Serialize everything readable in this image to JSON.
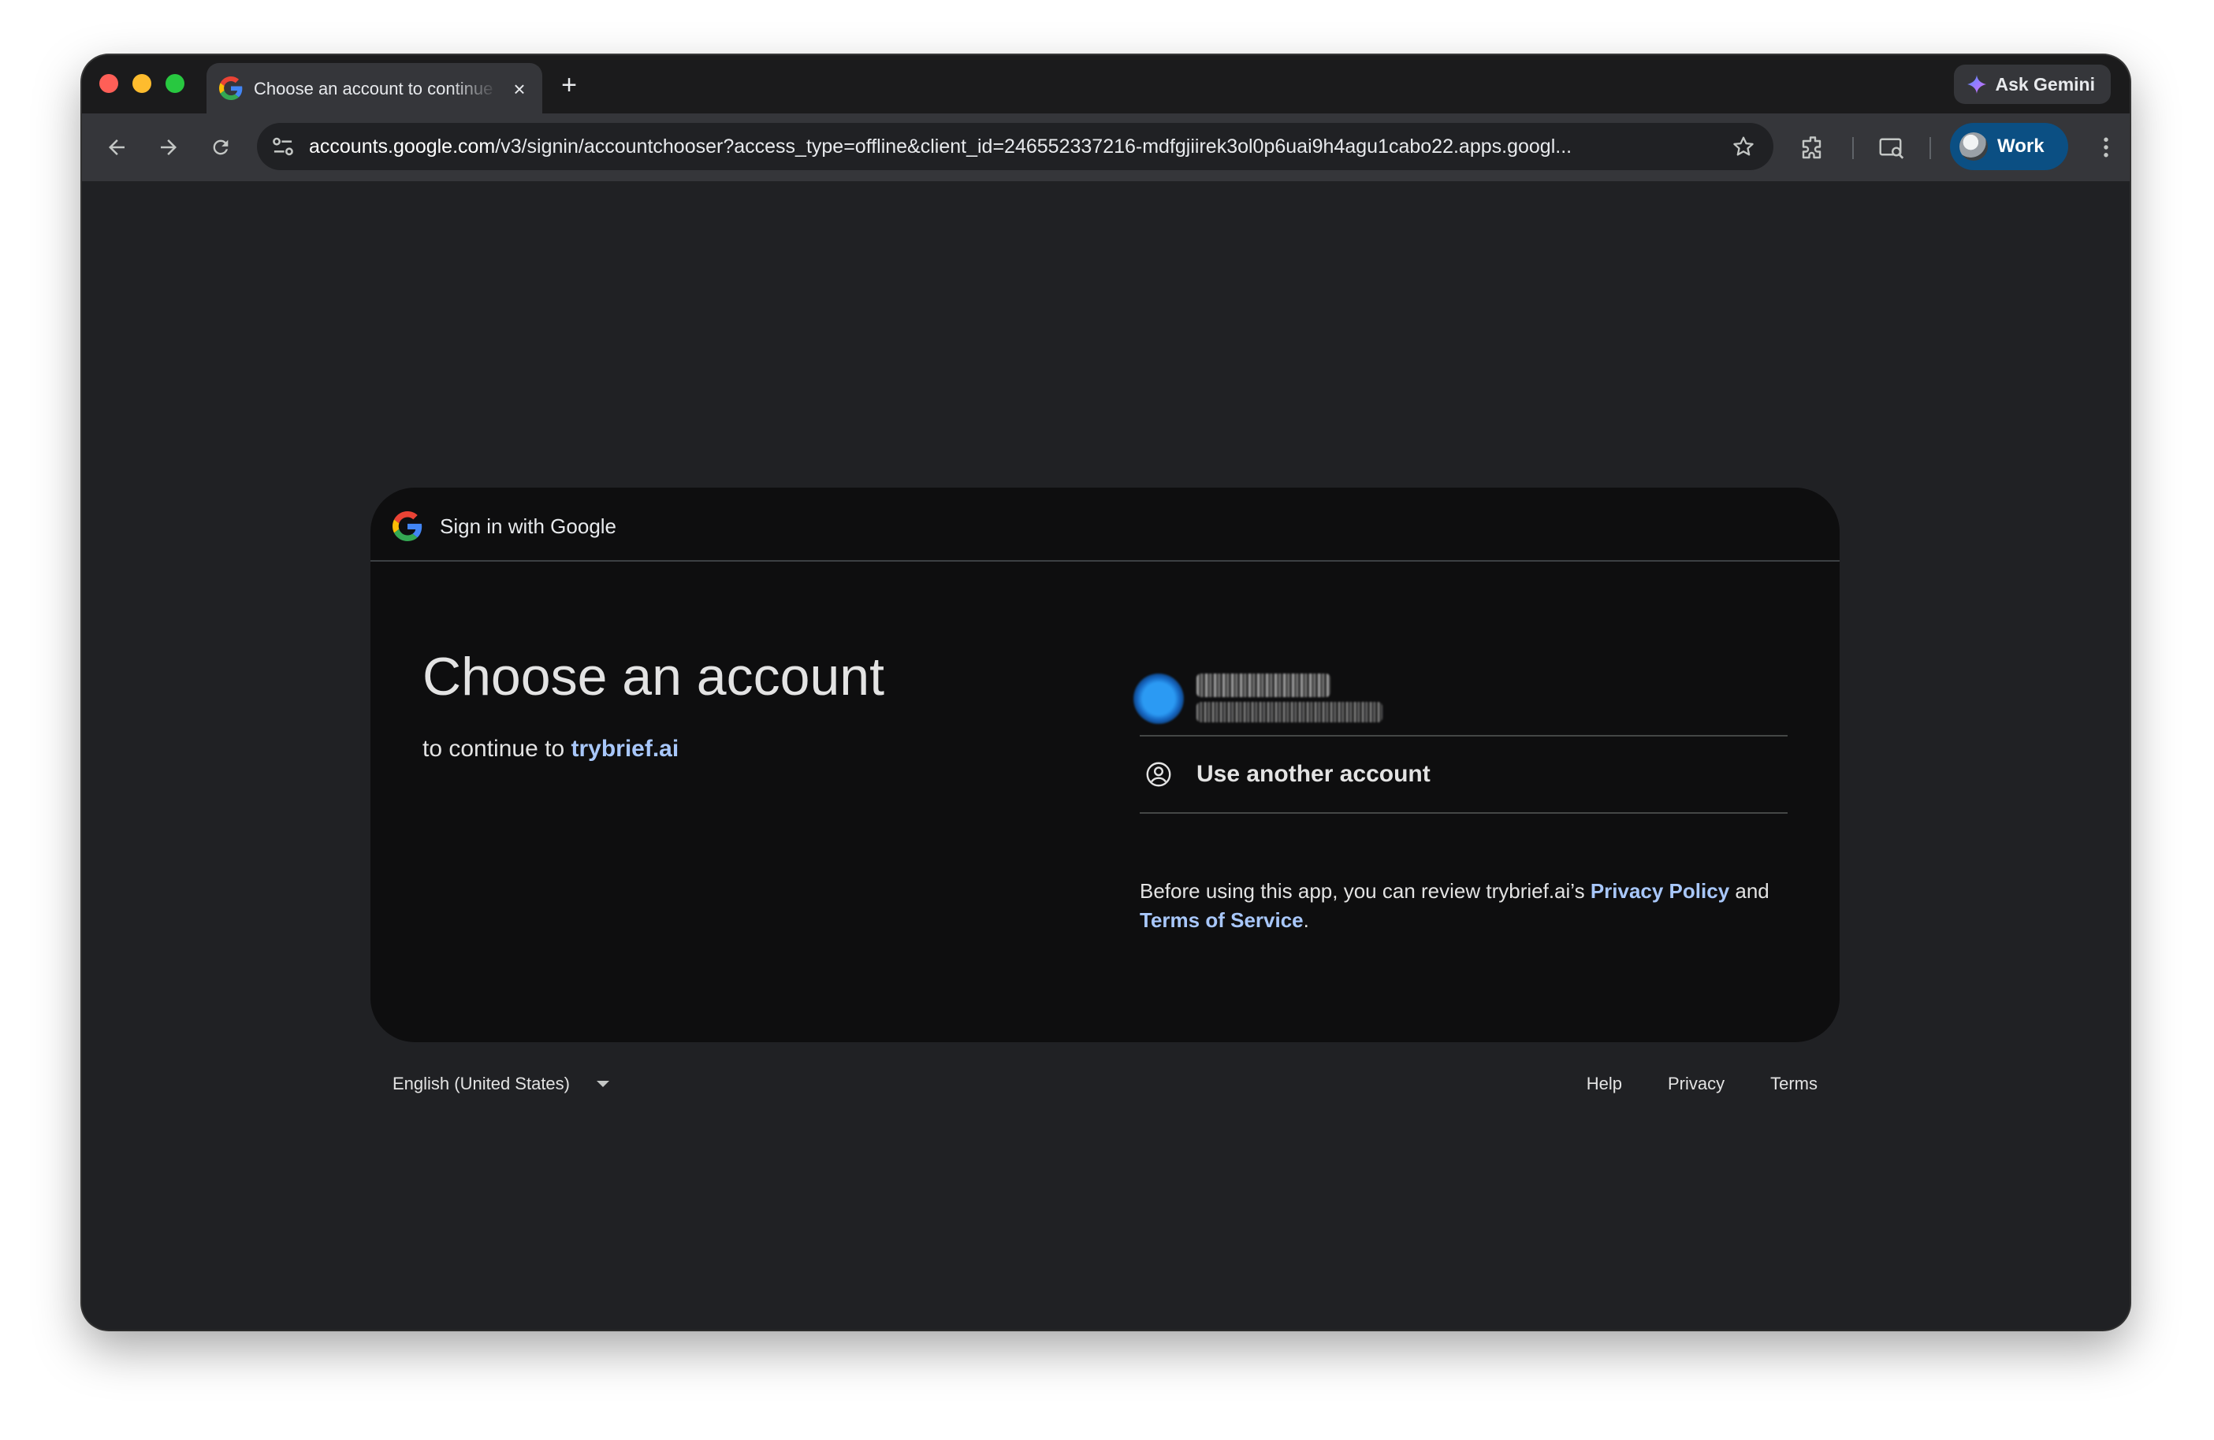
{
  "browser": {
    "tab": {
      "title": "Choose an account to continue",
      "close_glyph": "×",
      "favicon": "google-g-icon"
    },
    "new_tab_glyph": "+",
    "gemini_label": "Ask Gemini",
    "address": {
      "host": "accounts.google.com",
      "path": "/v3/signin/accountchooser?access_type=offline&client_id=246552337216-mdfgjiirek3ol0p6uai9h4agu1cabo22.apps.googl..."
    },
    "profile_label": "Work",
    "icons": [
      "back-arrow-icon",
      "forward-arrow-icon",
      "reload-icon",
      "site-info-icon",
      "star-icon",
      "extensions-icon",
      "cast-icon",
      "menu-dots-icon"
    ]
  },
  "card": {
    "header_title": "Sign in with Google",
    "headline": "Choose an account",
    "subhead_prefix": "to continue to ",
    "app_name": "trybrief.ai",
    "account": {
      "name": "",
      "email": ""
    },
    "use_another_label": "Use another account",
    "legal": {
      "prefix": "Before using this app, you can review trybrief.ai’s ",
      "privacy_link": "Privacy Policy",
      "middle": " and ",
      "terms_link": "Terms of Service",
      "suffix": "."
    }
  },
  "footer": {
    "language": "English (United States)",
    "links": [
      "Help",
      "Privacy",
      "Terms"
    ]
  },
  "colors": {
    "page_bg": "#202124",
    "card_bg": "#0e0e0f",
    "link": "#a8c7fa",
    "profile_chip": "#0b4f83"
  }
}
